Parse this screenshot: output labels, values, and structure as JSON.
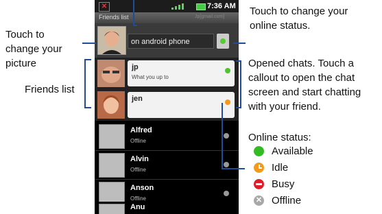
{
  "status_bar": {
    "time": "7:36 AM"
  },
  "app": {
    "title": "Friends list",
    "title_right": "Jp[gmail.com]"
  },
  "me": {
    "status_message": "on android phone"
  },
  "chats": [
    {
      "name": "jp",
      "message": "What you up to",
      "status_color": "#4fc430"
    },
    {
      "name": "jen",
      "message": "",
      "status_color": "#f39a1c"
    }
  ],
  "friends": [
    {
      "name": "Alfred",
      "status": "Offline"
    },
    {
      "name": "Alvin",
      "status": "Offline"
    },
    {
      "name": "Anson",
      "status": "Offline"
    },
    {
      "name": "Anu",
      "status": ""
    }
  ],
  "callouts": {
    "online_status": [
      "Touch to change your",
      "online status."
    ],
    "picture": [
      "Touch to",
      "change your",
      "picture"
    ],
    "friends_list": "Friends list",
    "opened_chats": [
      "Opened chats. Touch a",
      "callout to open the chat",
      "screen and start chatting",
      "with your friend."
    ]
  },
  "legend": {
    "title": "Online status:",
    "items": [
      {
        "label": "Available",
        "color": "#33bb22",
        "icon": "available-icon"
      },
      {
        "label": "Idle",
        "color": "#f39a1c",
        "icon": "idle-icon"
      },
      {
        "label": "Busy",
        "color": "#dd1d2a",
        "icon": "busy-icon"
      },
      {
        "label": "Offline",
        "color": "#a8a8a8",
        "icon": "offline-icon"
      }
    ]
  }
}
